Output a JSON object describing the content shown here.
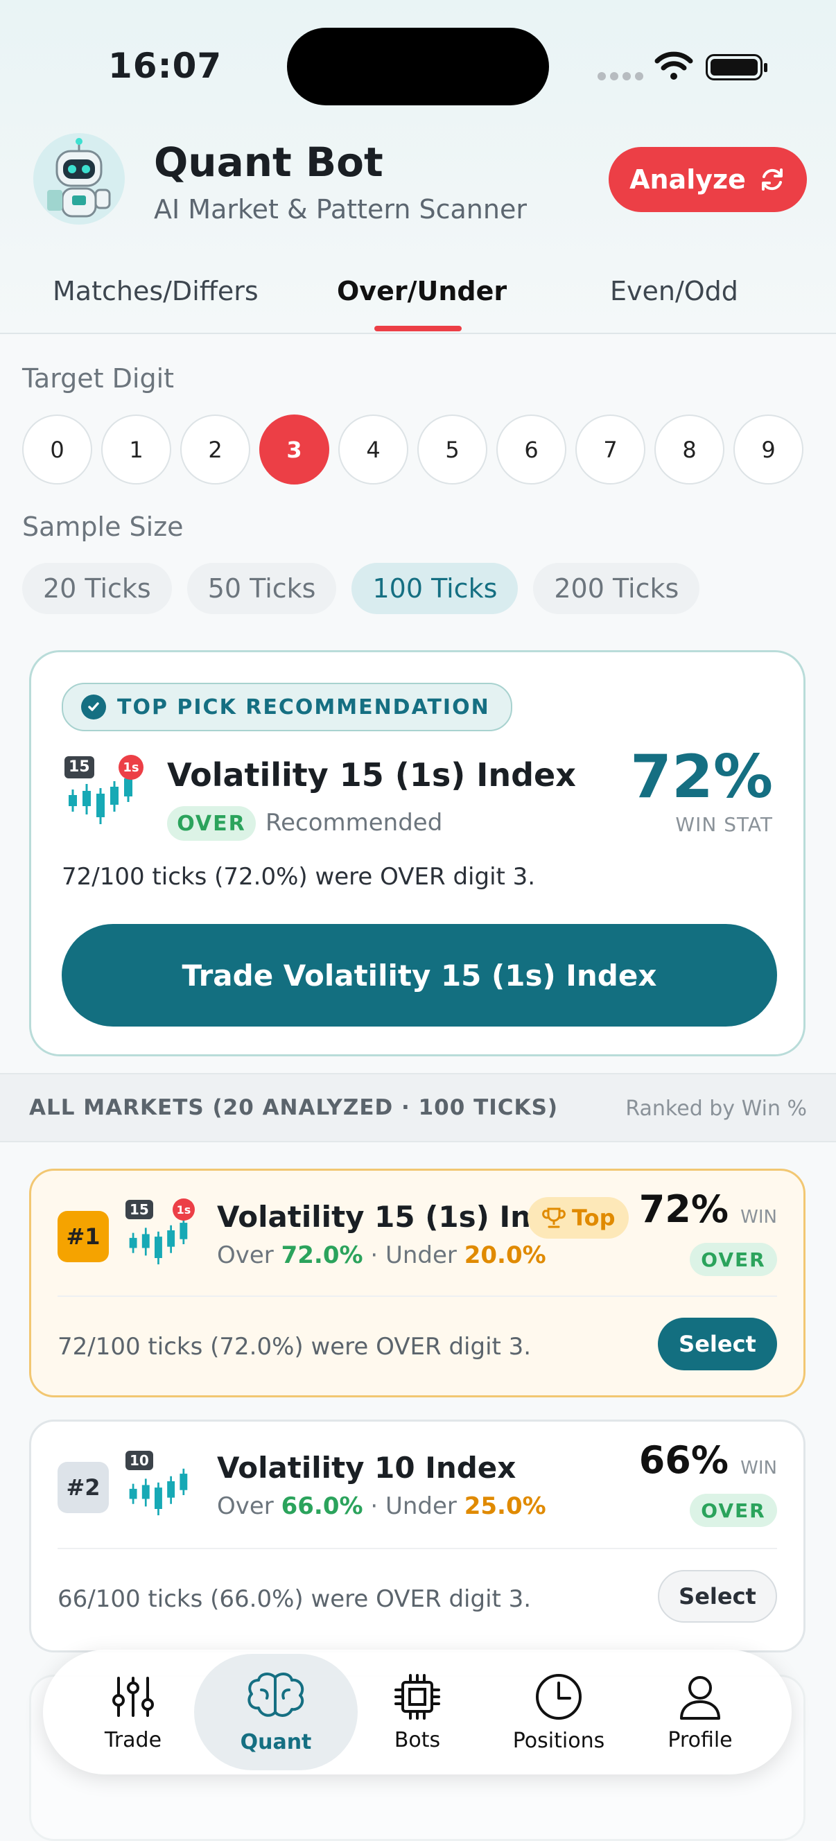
{
  "status_bar": {
    "time": "16:07"
  },
  "header": {
    "title": "Quant Bot",
    "subtitle": "AI Market & Pattern Scanner",
    "analyze_label": "Analyze"
  },
  "tabs": [
    {
      "label": "Matches/Differs",
      "active": false
    },
    {
      "label": "Over/Under",
      "active": true
    },
    {
      "label": "Even/Odd",
      "active": false
    }
  ],
  "target_digit": {
    "label": "Target Digit",
    "digits": [
      "0",
      "1",
      "2",
      "3",
      "4",
      "5",
      "6",
      "7",
      "8",
      "9"
    ],
    "selected": "3"
  },
  "sample_size": {
    "label": "Sample Size",
    "options": [
      "20 Ticks",
      "50 Ticks",
      "100 Ticks",
      "200 Ticks"
    ],
    "selected": "100 Ticks"
  },
  "top_pick": {
    "badge": "TOP PICK RECOMMENDATION",
    "market_badge": "15",
    "interval_badge": "1s",
    "market": "Volatility 15 (1s) Index",
    "direction": "OVER",
    "recommended": "Recommended",
    "win_pct": "72%",
    "win_label": "WIN STAT",
    "description": "72/100 ticks (72.0%) were OVER digit 3.",
    "trade_label": "Trade Volatility 15 (1s) Index"
  },
  "all_markets": {
    "title": "ALL MARKETS (20 ANALYZED · 100 TICKS)",
    "ranked_label": "Ranked by Win %",
    "items": [
      {
        "rank": "#1",
        "market_badge": "15",
        "interval_badge": "1s",
        "name": "Volatility 15 (1s) Index",
        "tag": "Top",
        "over_label": "Over",
        "over_value": "72.0%",
        "sep": "·",
        "under_label": "Under",
        "under_value": "20.0%",
        "win_pct": "72%",
        "win_label": "WIN",
        "direction": "OVER",
        "description": "72/100 ticks (72.0%) were OVER digit 3.",
        "select_label": "Select"
      },
      {
        "rank": "#2",
        "market_badge": "10",
        "name": "Volatility 10 Index",
        "over_label": "Over",
        "over_value": "66.0%",
        "sep": "·",
        "under_label": "Under",
        "under_value": "25.0%",
        "win_pct": "66%",
        "win_label": "WIN",
        "direction": "OVER",
        "description": "66/100 ticks (66.0%) were OVER digit 3.",
        "select_label": "Select"
      }
    ]
  },
  "bottom_nav": [
    {
      "label": "Trade",
      "icon": "sliders-icon",
      "active": false
    },
    {
      "label": "Quant",
      "icon": "brain-icon",
      "active": true
    },
    {
      "label": "Bots",
      "icon": "chip-icon",
      "active": false
    },
    {
      "label": "Positions",
      "icon": "clock-icon",
      "active": false
    },
    {
      "label": "Profile",
      "icon": "user-icon",
      "active": false
    }
  ],
  "colors": {
    "accent_red": "#ec3f46",
    "primary_teal": "#136f80",
    "success_green": "#2ba35c",
    "warning_orange": "#e08a00"
  }
}
